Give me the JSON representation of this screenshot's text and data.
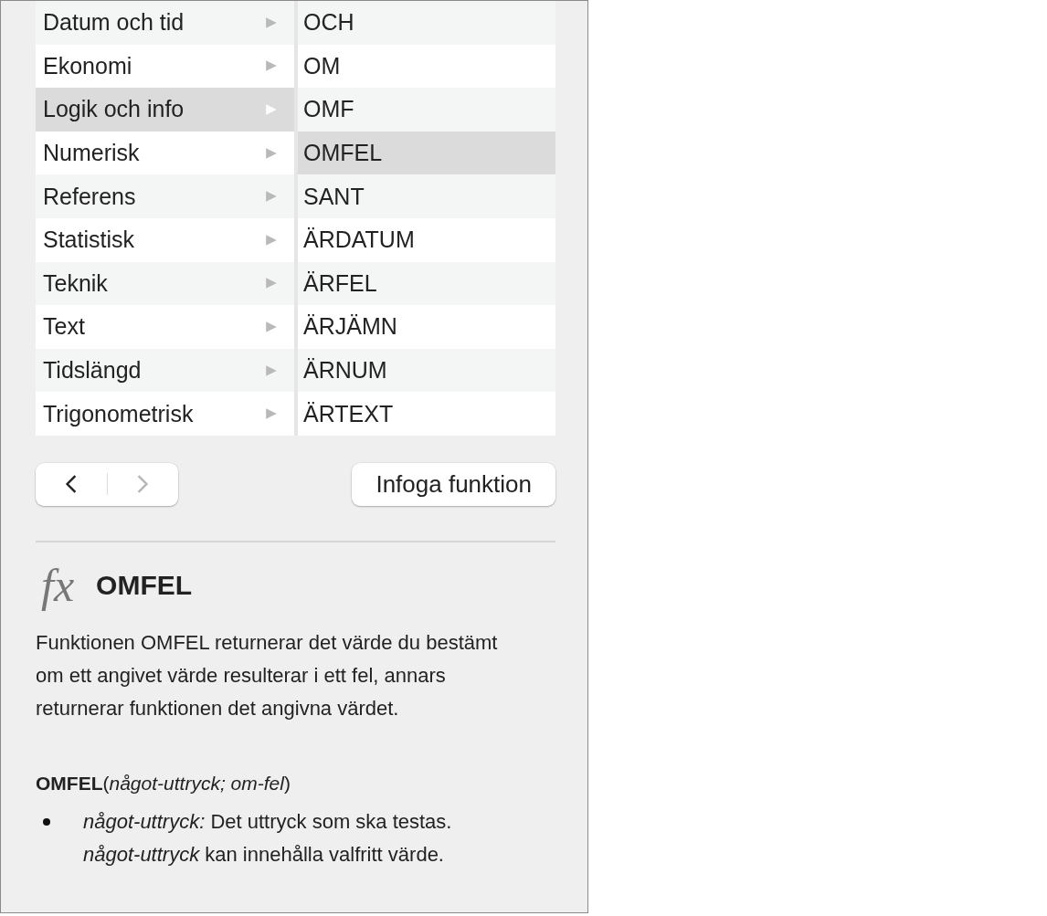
{
  "categories": [
    {
      "label": "Datum och tid",
      "selected": false
    },
    {
      "label": "Ekonomi",
      "selected": false
    },
    {
      "label": "Logik och info",
      "selected": true
    },
    {
      "label": "Numerisk",
      "selected": false
    },
    {
      "label": "Referens",
      "selected": false
    },
    {
      "label": "Statistisk",
      "selected": false
    },
    {
      "label": "Teknik",
      "selected": false
    },
    {
      "label": "Text",
      "selected": false
    },
    {
      "label": "Tidslängd",
      "selected": false
    },
    {
      "label": "Trigonometrisk",
      "selected": false
    }
  ],
  "functions": [
    {
      "label": "OCH",
      "selected": false
    },
    {
      "label": "OM",
      "selected": false
    },
    {
      "label": "OMF",
      "selected": false
    },
    {
      "label": "OMFEL",
      "selected": true
    },
    {
      "label": "SANT",
      "selected": false
    },
    {
      "label": "ÄRDATUM",
      "selected": false
    },
    {
      "label": "ÄRFEL",
      "selected": false
    },
    {
      "label": "ÄRJÄMN",
      "selected": false
    },
    {
      "label": "ÄRNUM",
      "selected": false
    },
    {
      "label": "ÄRTEXT",
      "selected": false
    }
  ],
  "navigation": {
    "back": {
      "disabled": false
    },
    "forward": {
      "disabled": true
    }
  },
  "insert_button": "Infoga funktion",
  "detail": {
    "icon_text": "fx",
    "name": "OMFEL",
    "description": "Funktionen OMFEL returnerar det värde du bestämt om ett angivet värde resulterar i ett fel, annars returnerar funktionen det angivna värdet.",
    "syntax": "**OMFEL**(*något-uttryck; om-fel*)",
    "arguments": [
      "*något-uttryck:* Det uttryck som ska testas. *något-uttryck* kan innehålla valfritt värde."
    ]
  }
}
